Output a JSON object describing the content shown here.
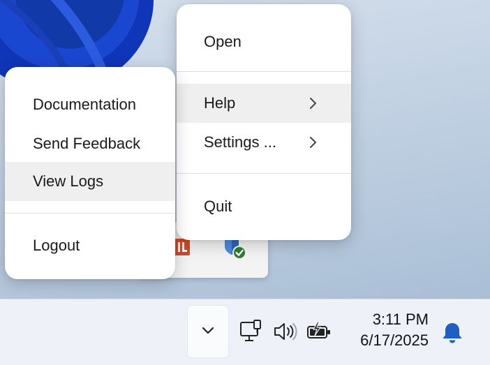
{
  "main_menu": {
    "open_label": "Open",
    "help_label": "Help",
    "settings_label": "Settings ...",
    "quit_label": "Quit"
  },
  "help_submenu": {
    "documentation_label": "Documentation",
    "send_feedback_label": "Send Feedback",
    "view_logs_label": "View Logs",
    "logout_label": "Logout"
  },
  "taskbar": {
    "time": "3:11 PM",
    "date": "6/17/2025",
    "icons": [
      "chevron-up-icon",
      "network-icon",
      "volume-icon",
      "battery-charging-icon",
      "notification-bell-icon"
    ]
  },
  "tray_overflow": {
    "icons": [
      "app-tray-icon",
      "shield-check-icon"
    ]
  },
  "colors": {
    "highlight": "#efefef",
    "bell": "#1f5fc4",
    "check_badge": "#2e7d32",
    "app_icon": "#d24a2a"
  }
}
